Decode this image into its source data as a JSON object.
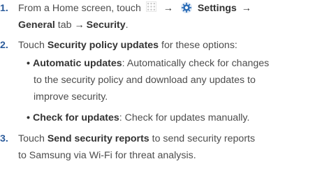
{
  "steps": [
    {
      "number": "1.",
      "line1": {
        "text1": "From a Home screen, touch",
        "arrow1": "→",
        "settings": "Settings",
        "arrow2": "→"
      },
      "line2": {
        "general": "General",
        "tab_text": " tab ",
        "arrow": "→",
        "security": "Security",
        "period": "."
      }
    },
    {
      "number": "2.",
      "text1": "Touch ",
      "bold": "Security policy updates",
      "text2": " for these options:",
      "bullets": [
        {
          "bullet": "•",
          "title": "Automatic updates",
          "line1": ": Automatically check for changes",
          "line2": "to the security policy and download any updates to",
          "line3": "improve security."
        },
        {
          "bullet": "•",
          "title": "Check for updates",
          "line1": ": Check for updates manually."
        }
      ]
    },
    {
      "number": "3.",
      "text1": "Touch ",
      "bold": "Send security reports",
      "text2": " to send security reports",
      "line2": "to Samsung via Wi-Fi for threat analysis."
    }
  ],
  "icons": {
    "apps": "apps-grid-icon",
    "settings": "settings-gear-icon"
  },
  "colors": {
    "step_number": "#2a5a9a",
    "body_text": "#4d4d4d",
    "bold_text": "#333333",
    "gear_icon": "#2e6fb8"
  }
}
